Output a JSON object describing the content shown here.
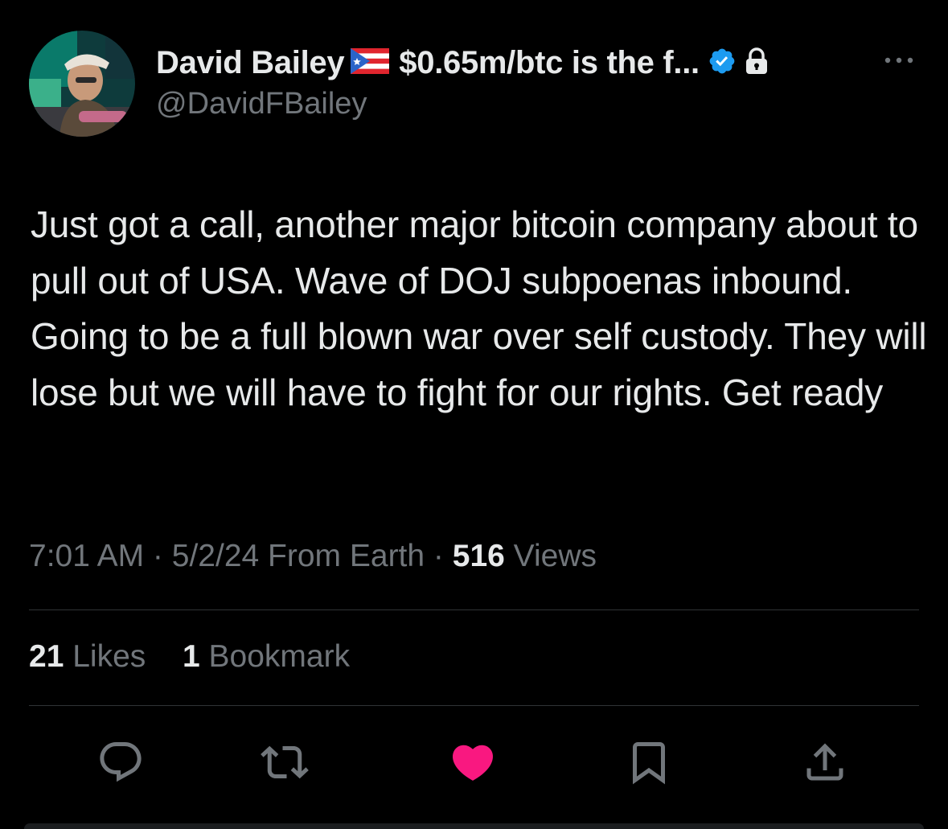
{
  "user": {
    "display_name": "David Bailey",
    "bio_snippet": "$0.65m/btc is the f...",
    "handle": "@DavidFBailey"
  },
  "icons": {
    "flag": "puerto-rico-flag-icon",
    "verified": "verified-badge-icon",
    "lock": "lock-icon",
    "more": "more-icon",
    "reply": "reply-icon",
    "retweet": "retweet-icon",
    "like": "like-icon",
    "bookmark": "bookmark-icon",
    "share": "share-icon"
  },
  "tweet": {
    "text": "Just got a call, another major bitcoin company about to pull out of USA. Wave of DOJ subpoenas inbound. Going to be a full blown war over self custody. They will lose but we will have to fight for our rights. Get ready"
  },
  "meta": {
    "time": "7:01 AM",
    "sep1": " · ",
    "date": "5/2/24",
    "source": " From Earth",
    "sep2": " · ",
    "views_count": "516",
    "views_label": " Views"
  },
  "stats": {
    "likes_count": "21",
    "likes_label": " Likes",
    "bookmarks_count": "1",
    "bookmarks_label": " Bookmark"
  },
  "colors": {
    "background": "#000000",
    "text_primary": "#e7e9ea",
    "text_secondary": "#71767b",
    "divider": "#2f3336",
    "verified_blue": "#1d9bf0",
    "like_pink": "#f91880"
  }
}
